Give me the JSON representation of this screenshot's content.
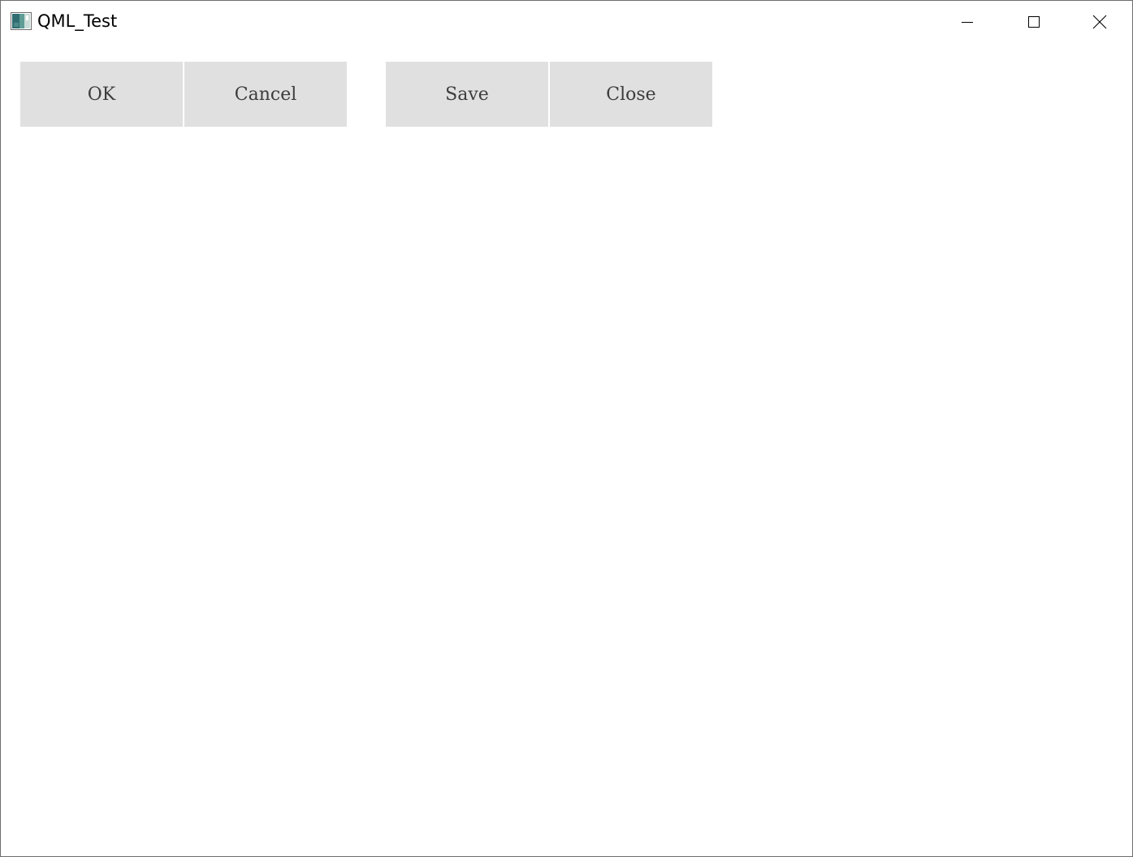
{
  "window": {
    "title": "QML_Test",
    "app_icon": "qt-app-icon",
    "controls": {
      "minimize_icon": "minimize-icon",
      "maximize_icon": "maximize-icon",
      "close_icon": "close-icon"
    }
  },
  "button_groups": [
    {
      "buttons": [
        {
          "label": "OK"
        },
        {
          "label": "Cancel"
        }
      ]
    },
    {
      "buttons": [
        {
          "label": "Save"
        },
        {
          "label": "Close"
        }
      ]
    }
  ],
  "colors": {
    "button_background": "#e0e0e0",
    "button_text": "#3d3d3d",
    "window_background": "#ffffff",
    "window_border": "#6e6e6e"
  }
}
